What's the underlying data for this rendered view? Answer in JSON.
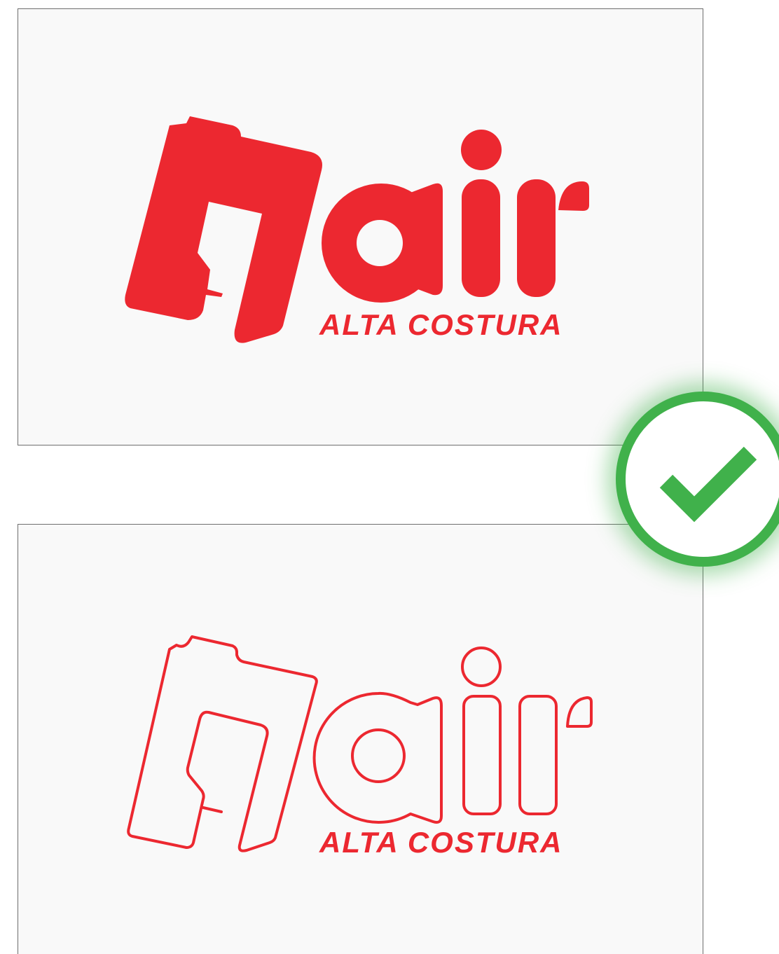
{
  "brand": {
    "name": "nair",
    "tagline": "ALTA COSTURA",
    "color": "#ec2830"
  },
  "variants": [
    {
      "style": "solid"
    },
    {
      "style": "outline"
    }
  ],
  "badge": {
    "icon": "checkmark-icon",
    "status": "approved",
    "color": "#40b14b"
  }
}
